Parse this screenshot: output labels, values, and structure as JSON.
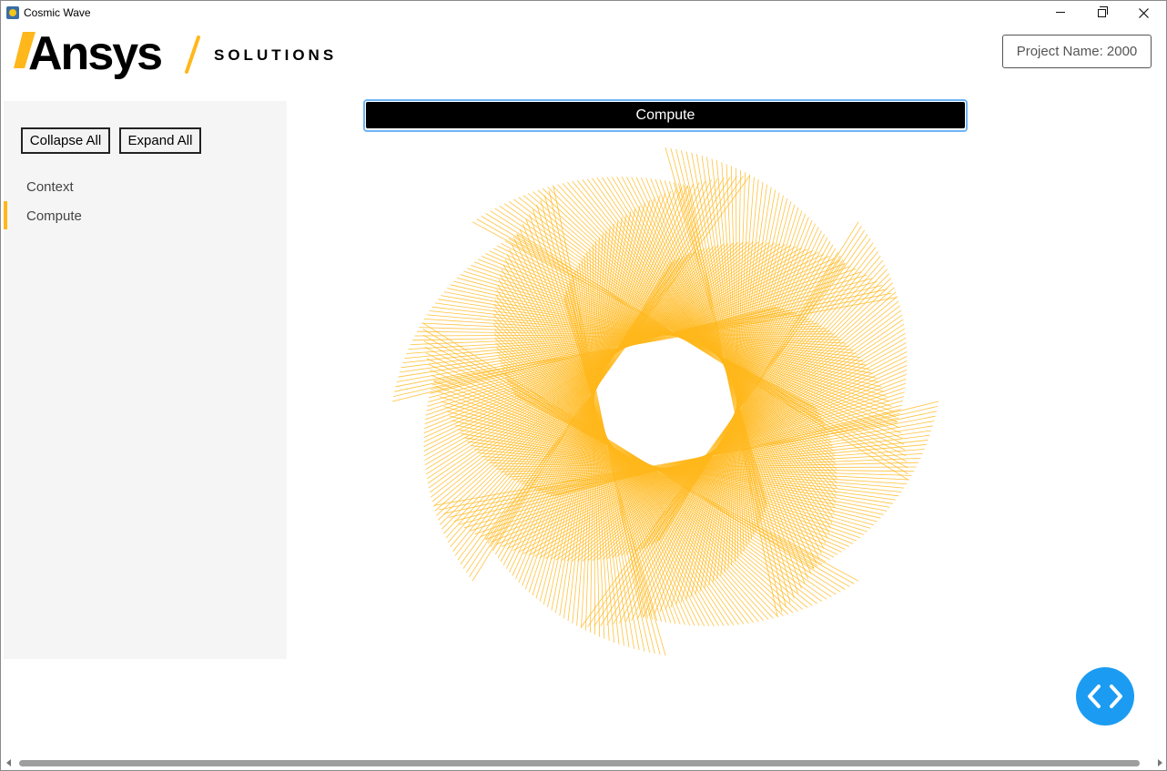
{
  "window": {
    "title": "Cosmic Wave"
  },
  "header": {
    "brand_name": "Ansys",
    "brand_suffix": "SOLUTIONS",
    "project_name": "Project Name: 2000"
  },
  "sidebar": {
    "collapse_label": "Collapse All",
    "expand_label": "Expand All",
    "items": [
      {
        "label": "Context",
        "active": false
      },
      {
        "label": "Compute",
        "active": true
      }
    ]
  },
  "main": {
    "compute_label": "Compute"
  },
  "colors": {
    "accent": "#ffb71b",
    "wave_stroke": "#ffb71b",
    "fab": "#1b9cf2"
  },
  "icons": {
    "app": "python-app-icon",
    "fab": "code-brackets-icon"
  }
}
